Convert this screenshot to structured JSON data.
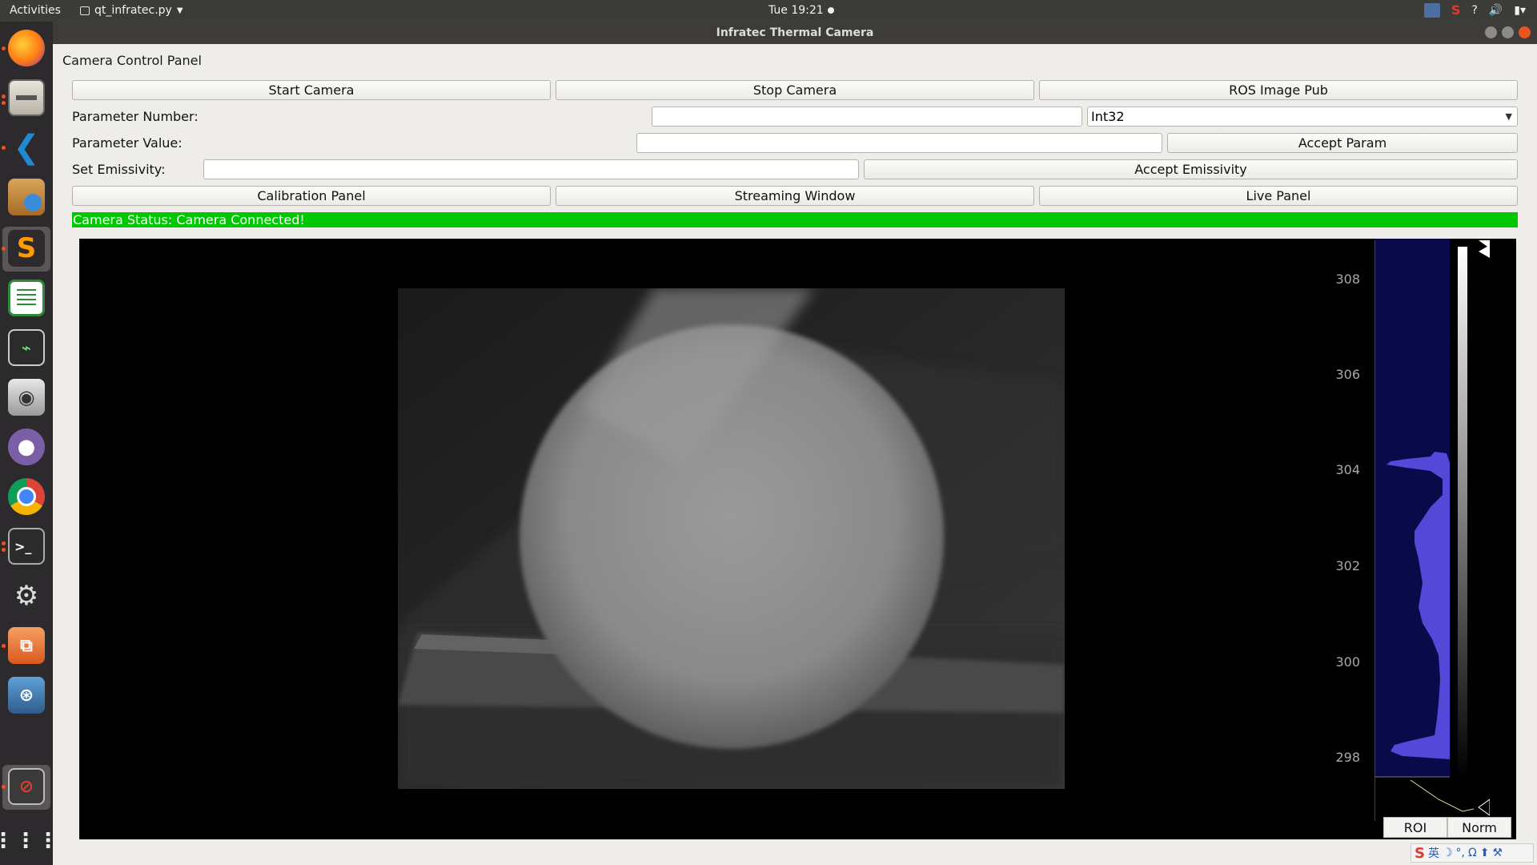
{
  "topbar": {
    "activities": "Activities",
    "app_menu": "qt_infratec.py",
    "clock": "Tue 19:21",
    "tray_icons": [
      "screen-icon",
      "sogou-icon",
      "help-icon",
      "volume-icon",
      "battery-icon"
    ],
    "tray_help": "?"
  },
  "dock": {
    "apps": [
      "firefox-icon",
      "files-icon",
      "vscode-icon",
      "archive-manager-icon",
      "sublime-text-icon",
      "spreadsheet-icon",
      "system-monitor-icon",
      "camera-icon",
      "github-icon",
      "chrome-icon",
      "terminal-icon",
      "settings-tools-icon",
      "software-center-icon",
      "screen-recorder-icon",
      "blocked-app-icon",
      "show-apps-icon"
    ]
  },
  "window": {
    "title": "Infratec Thermal Camera"
  },
  "panel": {
    "title": "Camera Control Panel",
    "row1": {
      "start": "Start Camera",
      "stop": "Stop Camera",
      "ros": "ROS Image Pub"
    },
    "param_number_label": "Parameter Number:",
    "param_number_value": "",
    "param_type": "Int32",
    "param_value_label": "Parameter Value:",
    "param_value_value": "",
    "accept_param": "Accept Param",
    "emissivity_label": "Set Emissivity:",
    "emissivity_value": "",
    "accept_emissivity": "Accept Emissivity",
    "row4": {
      "calibration": "Calibration Panel",
      "streaming": "Streaming Window",
      "live": "Live Panel"
    },
    "status": "Camera Status: Camera Connected!",
    "status_color": "#00c800"
  },
  "histogram": {
    "ticks": [
      "308",
      "306",
      "304",
      "302",
      "300",
      "298"
    ],
    "roi": "ROI",
    "norm": "Norm",
    "fill_color": "#5548d8",
    "bg_color": "#0a0a4a"
  },
  "ime": {
    "label": "英"
  }
}
